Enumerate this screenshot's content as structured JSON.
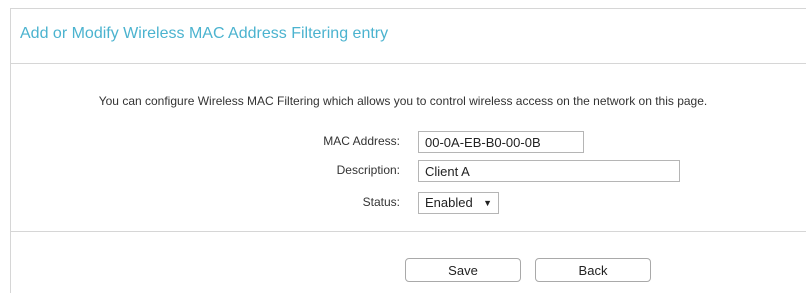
{
  "header": {
    "title": "Add or Modify Wireless MAC Address Filtering entry"
  },
  "intro_text": "You can configure Wireless MAC Filtering which allows you to control wireless access on the network on this page.",
  "form": {
    "mac_label": "MAC Address:",
    "mac_value": "00-0A-EB-B0-00-0B",
    "description_label": "Description:",
    "description_value": "Client A",
    "status_label": "Status:",
    "status_value": "Enabled",
    "status_arrow_icon": "triangle-down"
  },
  "buttons": {
    "save_label": "Save",
    "back_label": "Back"
  },
  "colors": {
    "title": "#4bb3cf",
    "border": "#d6d6d6"
  }
}
